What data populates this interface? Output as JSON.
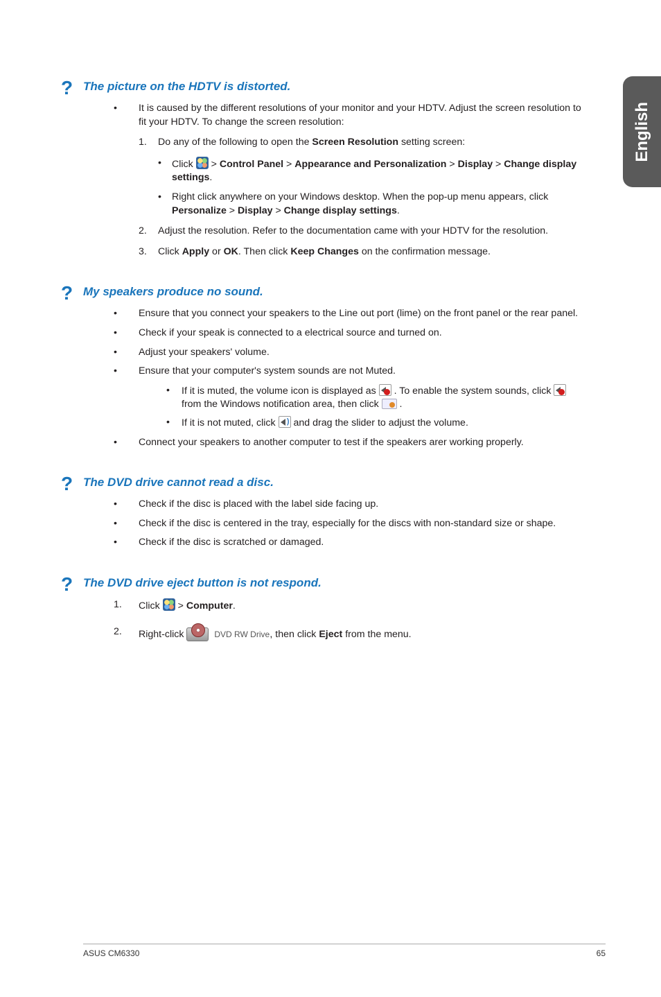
{
  "side_tab": "English",
  "q1": {
    "title": "The picture on the HDTV is distorted.",
    "intro": "It is caused by the different resolutions of your monitor and your HDTV. Adjust the screen resolution to fit your HDTV. To change the screen resolution:",
    "step1": {
      "num": "1.",
      "text_a": "Do any of the following to open the ",
      "bold_a": "Screen Resolution",
      "text_b": " setting screen:"
    },
    "sub1": {
      "a": "Click ",
      "b": " > ",
      "cp": "Control Panel",
      "c": " > ",
      "ap": "Appearance and Personalization",
      "d": " > ",
      "disp": "Display",
      "e": " > ",
      "cds": "Change display settings",
      "f": "."
    },
    "sub2": {
      "a": "Right click anywhere on your Windows desktop. When the pop-up menu appears, click ",
      "p": "Personalize",
      "b": " > ",
      "d": "Display",
      "c": " > ",
      "cds": "Change display settings",
      "e": "."
    },
    "step2": {
      "num": "2.",
      "text": "Adjust the resolution. Refer to the documentation came with your HDTV for the resolution."
    },
    "step3": {
      "num": "3.",
      "a": "Click ",
      "apply": "Apply",
      "b": " or ",
      "ok": "OK",
      "c": ". Then click ",
      "kc": "Keep Changes",
      "d": " on the confirmation message."
    }
  },
  "q2": {
    "title": "My speakers produce no sound.",
    "b1": "Ensure that you connect your speakers to the Line out port (lime) on the front panel or the rear panel.",
    "b2": "Check if your speak is connected to a electrical source and turned on.",
    "b3": "Adjust your speakers' volume.",
    "b4": "Ensure that your computer's system sounds are not Muted.",
    "b4s1": {
      "a": "If it is muted, the volume icon is displayed as ",
      "b": " . To enable the system sounds, click ",
      "c": " from the Windows notification area, then click ",
      "d": " ."
    },
    "b4s2": {
      "a": "If it is not muted, click ",
      "b": " and drag the slider to adjust the volume."
    },
    "b5": "Connect your speakers to another computer to test if the speakers arer working properly."
  },
  "q3": {
    "title": "The DVD drive cannot read a disc.",
    "b1": "Check if the disc is placed with the label side facing up.",
    "b2": "Check if the disc is centered in the tray, especially for the discs with non-standard size or shape.",
    "b3": "Check if the disc is scratched or damaged."
  },
  "q4": {
    "title": "The DVD drive eject button is not respond.",
    "s1": {
      "num": "1.",
      "a": "Click ",
      "b": " > ",
      "comp": "Computer",
      "c": "."
    },
    "s2": {
      "num": "2.",
      "a": "Right-click ",
      "drive_label": "DVD RW Drive",
      "b": ", then click ",
      "ej": "Eject",
      "c": " from the menu."
    }
  },
  "footer": {
    "left": "ASUS CM6330",
    "right": "65"
  }
}
